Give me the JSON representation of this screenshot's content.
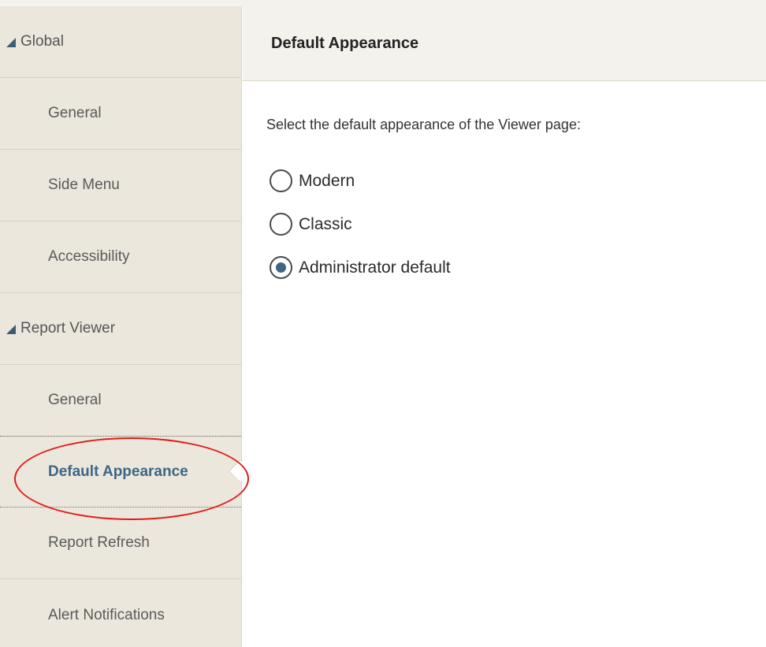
{
  "sidebar": {
    "groups": [
      {
        "label": "Global",
        "items": [
          "General",
          "Side Menu",
          "Accessibility"
        ]
      },
      {
        "label": "Report Viewer",
        "items": [
          "General",
          "Default Appearance",
          "Report Refresh",
          "Alert Notifications"
        ]
      }
    ],
    "selected_item": "Default Appearance"
  },
  "main": {
    "title": "Default Appearance",
    "prompt": "Select the default appearance of the Viewer page:",
    "options": [
      {
        "label": "Modern",
        "checked": false
      },
      {
        "label": "Classic",
        "checked": false
      },
      {
        "label": "Administrator default",
        "checked": true
      }
    ]
  },
  "colors": {
    "sidebar_bg": "#ebe7dc",
    "accent": "#3d6686",
    "highlight": "#e11b1b"
  }
}
